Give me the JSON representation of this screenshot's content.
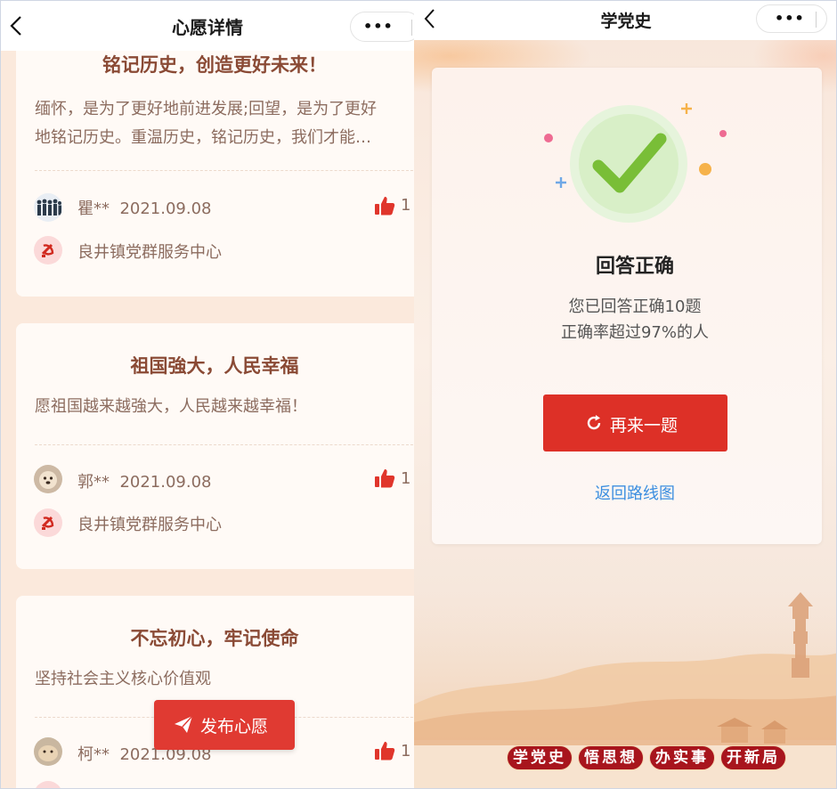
{
  "left": {
    "nav_title": "心愿详情",
    "publish_label": "发布心愿",
    "cards": [
      {
        "title": "铭记历史，创造更好未来！",
        "body_line1": "缅怀，是为了更好地前进发展;回望，是为了更好",
        "body_line2": "地铭记历史。重温历史，铭记历史，我们才能…",
        "author": "瞿**",
        "date": "2021.09.08",
        "likes": "1",
        "org": "良井镇党群服务中心"
      },
      {
        "title": "祖国強大，人民幸福",
        "body_line1": "愿祖国越来越強大，人民越来越幸福！",
        "author": "郭**",
        "date": "2021.09.08",
        "likes": "1",
        "org": "良井镇党群服务中心"
      },
      {
        "title": "不忘初心，牢记使命",
        "body_line1": "坚持社会主义核心价值观",
        "author": "柯**",
        "date": "2021.09.08",
        "likes": "1"
      }
    ]
  },
  "right": {
    "nav_title": "学党史",
    "result_title": "回答正确",
    "result_line1": "您已回答正确10题",
    "result_line2": "正确率超过97%的人",
    "again_label": "再来一题",
    "route_link": "返回路线图",
    "banner": [
      "学党史",
      "悟思想",
      "办实事",
      "开新局"
    ]
  },
  "colors": {
    "accent_red": "#dd3027",
    "card_title": "#8a4a35",
    "link_blue": "#3d8fe0",
    "check_green": "#7cc23a"
  }
}
